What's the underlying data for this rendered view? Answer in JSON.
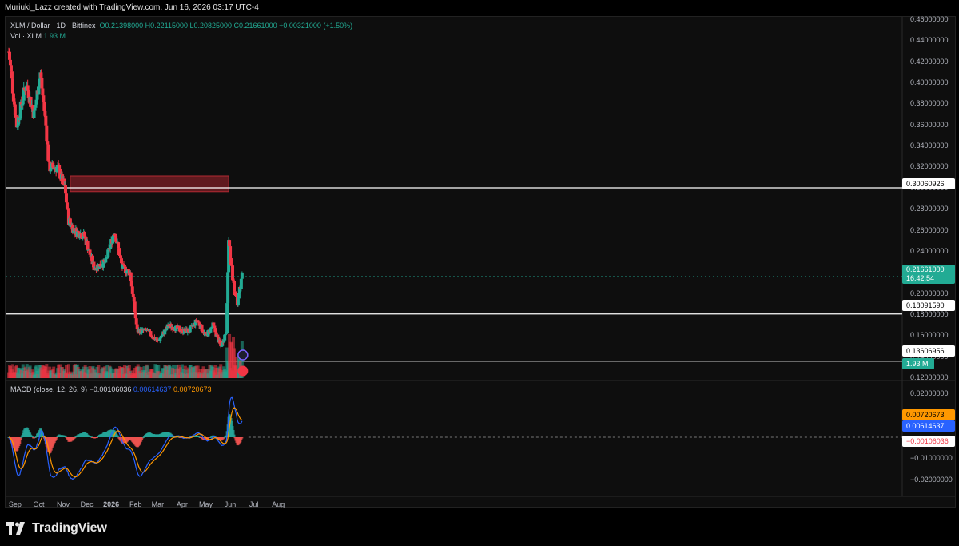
{
  "header": {
    "attribution": "Muriuki_Lazz created with TradingView.com, Jun 16, 2026 03:17 UTC-4"
  },
  "legend": {
    "symbol": "XLM / Dollar · 1D · Bitfinex",
    "ohlc": "O0.21398000  H0.22115000  L0.20825000  C0.21661000",
    "change": "+0.00321000 (+1.50%)",
    "volume_label": "Vol · XLM",
    "volume_value": "1.93 M",
    "macd_label": "MACD (close, 12, 26, 9)",
    "macd_hist": "−0.00106036",
    "macd_line": "0.00614637",
    "macd_signal": "0.00720673"
  },
  "price_axis": {
    "ticks": [
      "0.46000000",
      "0.44000000",
      "0.42000000",
      "0.40000000",
      "0.38000000",
      "0.36000000",
      "0.34000000",
      "0.32000000",
      "0.30000000",
      "0.28000000",
      "0.26000000",
      "0.24000000",
      "0.22000000",
      "0.20000000",
      "0.18000000",
      "0.16000000",
      "0.14000000",
      "0.12000000"
    ]
  },
  "price_tags": {
    "level_1": "0.30060926",
    "level_2": "0.18091590",
    "level_3": "0.13606956",
    "last_price": "0.21661000",
    "countdown": "16:42:54",
    "volume": "1.93 M"
  },
  "macd_axis": {
    "ticks": [
      "0.02000000",
      "0.01000000",
      "−0.01000000",
      "−0.02000000"
    ],
    "tag_signal": "0.00720673",
    "tag_macd": "0.00614637",
    "tag_hist": "−0.00106036"
  },
  "time_axis": {
    "labels": [
      "Sep",
      "Oct",
      "Nov",
      "Dec",
      "2026",
      "Feb",
      "Mar",
      "Apr",
      "May",
      "Jun",
      "Jul",
      "Aug"
    ]
  },
  "footer": {
    "logo_text": "TradingView"
  },
  "chart_data": {
    "type": "candlestick",
    "title": "XLM / Dollar · 1D · Bitfinex",
    "ylim": [
      0.12,
      0.46
    ],
    "horizontal_levels": [
      0.30060926,
      0.1809159,
      0.13606956
    ],
    "resistance_zone": [
      0.297,
      0.312
    ],
    "last_price": 0.21661,
    "path_keypoints": [
      [
        "Aug 24",
        0.43
      ],
      [
        "Sep 3",
        0.36
      ],
      [
        "Sep 15",
        0.4
      ],
      [
        "Sep 25",
        0.37
      ],
      [
        "Oct 3",
        0.41
      ],
      [
        "Oct 10",
        0.36
      ],
      [
        "Oct 14",
        0.32
      ],
      [
        "Oct 25",
        0.32
      ],
      [
        "Nov 3",
        0.3
      ],
      [
        "Nov 8",
        0.27
      ],
      [
        "Nov 15",
        0.26
      ],
      [
        "Nov 28",
        0.255
      ],
      [
        "Dec 10",
        0.225
      ],
      [
        "Dec 25",
        0.23
      ],
      [
        "Jan 5",
        0.26
      ],
      [
        "Jan 15",
        0.225
      ],
      [
        "Jan 25",
        0.22
      ],
      [
        "Feb 3",
        0.165
      ],
      [
        "Feb 15",
        0.165
      ],
      [
        "Mar 1",
        0.155
      ],
      [
        "Mar 15",
        0.17
      ],
      [
        "Apr 1",
        0.165
      ],
      [
        "Apr 10",
        0.165
      ],
      [
        "Apr 20",
        0.175
      ],
      [
        "May 1",
        0.16
      ],
      [
        "May 10",
        0.17
      ],
      [
        "May 20",
        0.15
      ],
      [
        "May 27",
        0.165
      ],
      [
        "May 30",
        0.25
      ],
      [
        "Jun 5",
        0.21
      ],
      [
        "Jun 10",
        0.19
      ],
      [
        "Jun 16",
        0.2166
      ]
    ]
  },
  "colors": {
    "up": "#22ab94",
    "down": "#f23645",
    "zone": "#6e1c22",
    "level_line": "#ffffff",
    "macd_line": "#2962ff",
    "signal_line": "#ff9800"
  }
}
